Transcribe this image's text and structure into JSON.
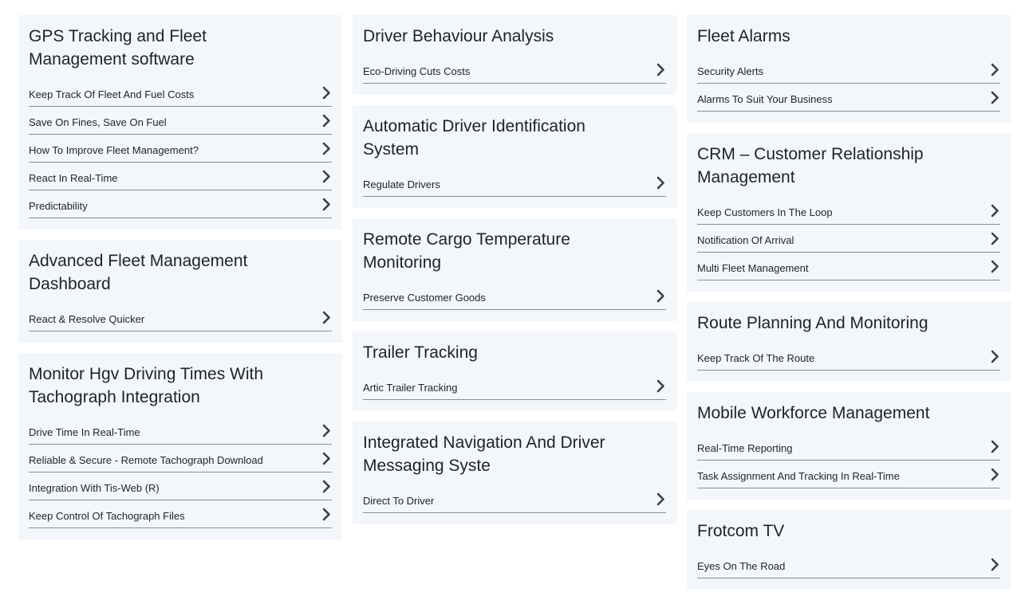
{
  "columns": [
    {
      "cards": [
        {
          "title": "GPS Tracking and Fleet Management software",
          "links": [
            "Keep Track Of Fleet And Fuel Costs",
            "Save On Fines, Save On Fuel",
            "How To Improve Fleet Management?",
            "React In Real-Time",
            "Predictability"
          ]
        },
        {
          "title": "Advanced Fleet Management Dashboard",
          "links": [
            "React & Resolve Quicker"
          ]
        },
        {
          "title": "Monitor Hgv Driving Times With Tachograph Integration",
          "links": [
            "Drive Time In Real-Time",
            "Reliable & Secure - Remote Tachograph Download",
            "Integration With Tis-Web (R)",
            "Keep Control Of Tachograph Files"
          ]
        }
      ]
    },
    {
      "cards": [
        {
          "title": "Driver Behaviour Analysis",
          "links": [
            "Eco-Driving Cuts Costs"
          ]
        },
        {
          "title": "Automatic Driver Identification System",
          "links": [
            "Regulate Drivers"
          ]
        },
        {
          "title": "Remote Cargo Temperature Monitoring",
          "links": [
            "Preserve Customer Goods"
          ]
        },
        {
          "title": "Trailer Tracking",
          "links": [
            "Artic Trailer Tracking"
          ]
        },
        {
          "title": "Integrated Navigation And Driver Messaging Syste",
          "links": [
            "Direct To Driver"
          ]
        }
      ]
    },
    {
      "cards": [
        {
          "title": "Fleet Alarms",
          "links": [
            "Security Alerts",
            "Alarms To Suit Your Business"
          ]
        },
        {
          "title": "CRM – Customer Relationship Management",
          "links": [
            "Keep Customers In The Loop",
            "Notification Of Arrival",
            "Multi Fleet Management"
          ]
        },
        {
          "title": "Route Planning And Monitoring",
          "links": [
            "Keep Track Of The Route"
          ]
        },
        {
          "title": "Mobile Workforce Management",
          "links": [
            "Real-Time Reporting",
            "Task Assignment And Tracking In Real-Time"
          ]
        },
        {
          "title": "Frotcom TV",
          "links": [
            "Eyes On The Road"
          ]
        }
      ]
    }
  ],
  "icons": {
    "link_chevron": "chevron-right-icon"
  },
  "colors": {
    "card_background": "#f3f6fb",
    "text": "#1f2329",
    "divider": "#8b8f94",
    "chevron": "#3c4046"
  }
}
